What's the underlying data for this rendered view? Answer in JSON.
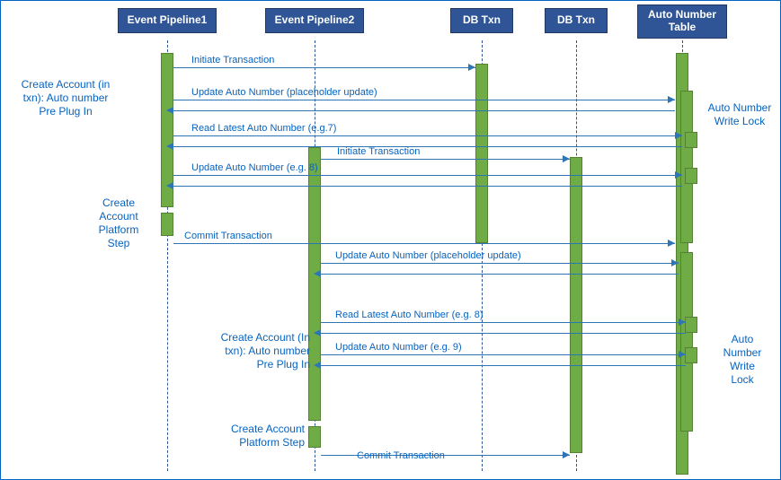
{
  "lanes": {
    "pipeline1": {
      "label": "Event Pipeline1"
    },
    "pipeline2": {
      "label": "Event Pipeline2"
    },
    "dbtxn1": {
      "label": "DB Txn"
    },
    "dbtxn2": {
      "label": "DB Txn"
    },
    "autonum": {
      "label": "Auto Number\nTable"
    }
  },
  "left_labels": {
    "create_account_plugin_1": "Create Account (in\ntxn): Auto number\nPre Plug In",
    "create_account_platform_1": "Create\nAccount\nPlatform\nStep",
    "create_account_plugin_2": "Create Account (In\ntxn): Auto number\nPre Plug In",
    "create_account_platform_2": "Create Account\nPlatform Step"
  },
  "right_labels": {
    "write_lock_1": "Auto Number\nWrite Lock",
    "write_lock_2": "Auto\nNumber\nWrite\nLock"
  },
  "messages": {
    "initiate_txn_1": "Initiate Transaction",
    "update_placeholder_1": "Update Auto Number (placeholder update)",
    "read_latest_1": "Read Latest Auto Number (e.g.7)",
    "initiate_txn_2": "Initiate Transaction",
    "update_num_8": "Update Auto Number (e.g. 8)",
    "commit_txn_1": "Commit Transaction",
    "update_placeholder_2": "Update Auto Number (placeholder update)",
    "read_latest_2": "Read Latest Auto Number (e.g. 8)",
    "update_num_9": "Update Auto Number (e.g. 9)",
    "commit_txn_2": "Commit Transaction"
  },
  "chart_data": {
    "type": "sequence-diagram",
    "lanes": [
      "Event Pipeline1",
      "Event Pipeline2",
      "DB Txn",
      "DB Txn",
      "Auto Number Table"
    ],
    "left_annotations": [
      {
        "text": "Create Account (in txn): Auto number Pre Plug In",
        "applies_to": "Event Pipeline1"
      },
      {
        "text": "Create Account Platform Step",
        "applies_to": "Event Pipeline1"
      },
      {
        "text": "Create Account (In txn): Auto number Pre Plug In",
        "applies_to": "Event Pipeline2"
      },
      {
        "text": "Create Account Platform Step",
        "applies_to": "Event Pipeline2"
      }
    ],
    "right_annotations": [
      {
        "text": "Auto Number Write Lock",
        "applies_to": "Auto Number Table",
        "phase": 1
      },
      {
        "text": "Auto Number Write Lock",
        "applies_to": "Auto Number Table",
        "phase": 2
      }
    ],
    "messages": [
      {
        "from": "Event Pipeline1",
        "to": "DB Txn(1)",
        "text": "Initiate Transaction",
        "dir": "request"
      },
      {
        "from": "Event Pipeline1",
        "to": "Auto Number Table",
        "text": "Update Auto Number (placeholder update)",
        "dir": "request"
      },
      {
        "from": "Auto Number Table",
        "to": "Event Pipeline1",
        "text": "Read Latest Auto Number (e.g.7)",
        "dir": "response"
      },
      {
        "from": "Event Pipeline2",
        "to": "DB Txn(2)",
        "text": "Initiate Transaction",
        "dir": "request"
      },
      {
        "from": "Event Pipeline1",
        "to": "Auto Number Table",
        "text": "Update Auto Number (e.g. 8)",
        "dir": "request"
      },
      {
        "from": "Event Pipeline1",
        "to": "Auto Number Table",
        "text": "Commit Transaction",
        "dir": "request"
      },
      {
        "from": "Event Pipeline2",
        "to": "Auto Number Table",
        "text": "Update Auto Number (placeholder update)",
        "dir": "request"
      },
      {
        "from": "Auto Number Table",
        "to": "Event Pipeline2",
        "text": "Read Latest Auto Number (e.g. 8)",
        "dir": "response"
      },
      {
        "from": "Event Pipeline2",
        "to": "Auto Number Table",
        "text": "Update Auto Number (e.g. 9)",
        "dir": "request"
      },
      {
        "from": "Event Pipeline2",
        "to": "DB Txn(2)",
        "text": "Commit Transaction",
        "dir": "request"
      }
    ]
  }
}
